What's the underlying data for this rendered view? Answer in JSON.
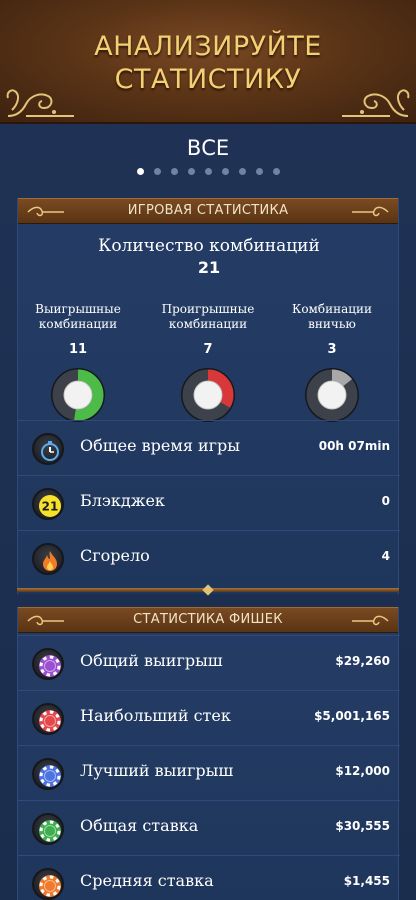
{
  "header": {
    "title_line1": "АНАЛИЗИРУЙТЕ",
    "title_line2": "СТАТИСТИКУ"
  },
  "page": {
    "section_title": "ВСЕ",
    "pager": {
      "count": 9,
      "active_index": 0
    }
  },
  "game_stats": {
    "header": "ИГРОВАЯ СТАТИСТИКА",
    "combinations_label": "Количество комбинаций",
    "combinations_value": "21",
    "gauges": [
      {
        "label_line1": "Выигрышные",
        "label_line2": "комбинации",
        "value": "11",
        "fraction": 0.524,
        "color": "#4dbb47"
      },
      {
        "label_line1": "Проигрышные",
        "label_line2": "комбинации",
        "value": "7",
        "fraction": 0.333,
        "color": "#d9383a"
      },
      {
        "label_line1": "Комбинации",
        "label_line2": "вничью",
        "value": "3",
        "fraction": 0.143,
        "color": "#a8a8a8"
      }
    ],
    "rows": [
      {
        "icon": "stopwatch-icon",
        "label": "Общее время игры",
        "value": "00h 07min"
      },
      {
        "icon": "blackjack-21-icon",
        "icon_text": "21",
        "label": "Блэкджек",
        "value": "0"
      },
      {
        "icon": "flame-icon",
        "label": "Сгорело",
        "value": "4"
      }
    ]
  },
  "chip_stats": {
    "header": "СТАТИСТИКА ФИШЕК",
    "rows": [
      {
        "icon": "purple-chip-icon",
        "color": "#9b4fd1",
        "label": "Общий выигрыш",
        "value": "$29,260"
      },
      {
        "icon": "red-chip-icon",
        "color": "#e4474c",
        "label": "Наибольший стек",
        "value": "$5,001,165"
      },
      {
        "icon": "blue-chip-icon",
        "color": "#4c73e0",
        "label": "Лучший выигрыш",
        "value": "$12,000"
      },
      {
        "icon": "green-chip-icon",
        "color": "#3fae4e",
        "label": "Общая ставка",
        "value": "$30,555"
      },
      {
        "icon": "orange-chip-icon",
        "color": "#f07a2c",
        "label": "Средняя ставка",
        "value": "$1,455"
      }
    ]
  }
}
